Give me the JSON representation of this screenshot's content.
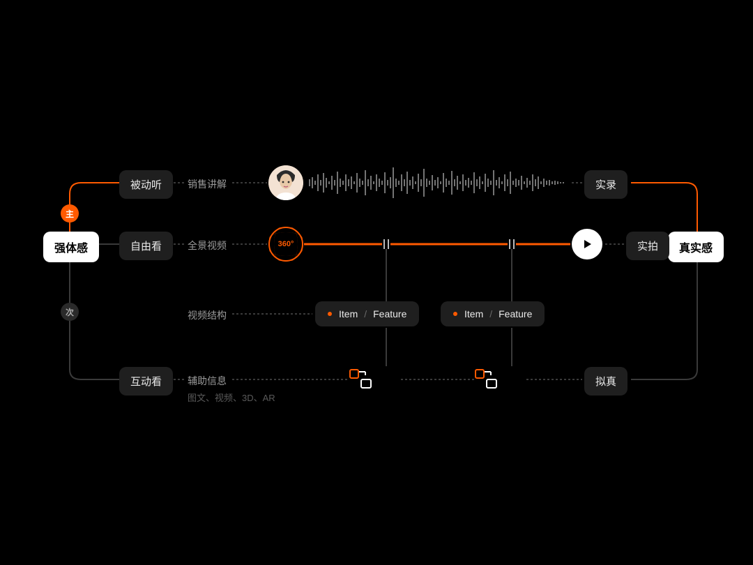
{
  "colors": {
    "accent": "#ff5a00",
    "bg": "#000000",
    "pill_dark": "#1f1f1f",
    "pill_white": "#ffffff",
    "text_muted": "#9b9b9b"
  },
  "badges": {
    "primary": "主",
    "secondary": "次"
  },
  "left_anchor": "强体感",
  "right_anchor": "真实感",
  "rows": {
    "top": {
      "left_pill": "被动听",
      "connector_label": "销售讲解",
      "right_pill": "实录"
    },
    "mid": {
      "left_pill": "自由看",
      "connector_label": "全景视频",
      "sphere_text": "360°",
      "right_pill": "实拍"
    },
    "structure": {
      "label": "视频结构",
      "feature_item": "Item",
      "feature_feature": "Feature"
    },
    "bottom": {
      "left_pill": "互动看",
      "connector_label": "辅助信息",
      "subnote": "图文、视频、3D、AR",
      "right_pill": "拟真"
    }
  }
}
